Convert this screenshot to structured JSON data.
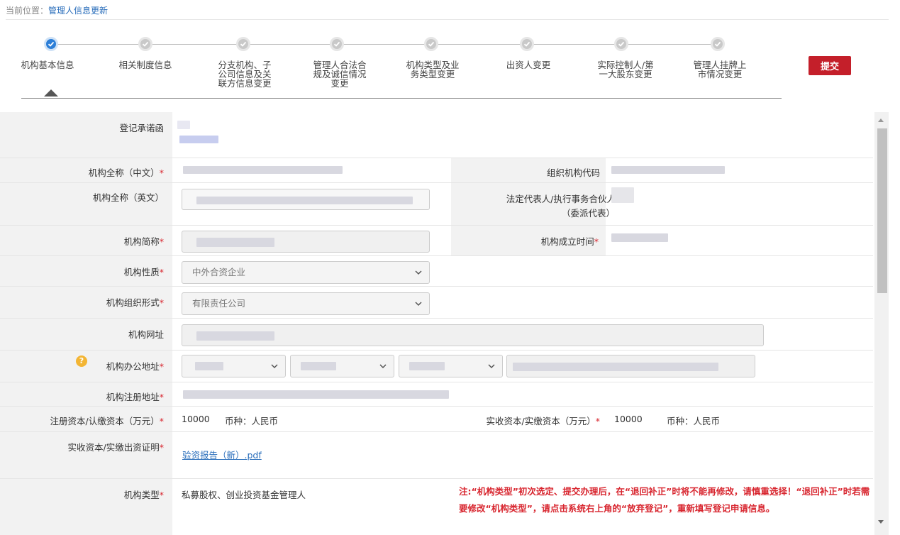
{
  "breadcrumb": {
    "prefix": "当前位置：",
    "current": "管理人信息更新"
  },
  "steps": [
    {
      "label": "机构基本信息",
      "state": "active"
    },
    {
      "label": "相关制度信息",
      "state": "done"
    },
    {
      "label": "分支机构、子\n公司信息及关\n联方信息变更",
      "state": "done"
    },
    {
      "label": "管理人合法合\n规及诚信情况\n变更",
      "state": "done"
    },
    {
      "label": "机构类型及业\n务类型变更",
      "state": "done"
    },
    {
      "label": "出资人变更",
      "state": "done"
    },
    {
      "label": "实际控制人/第\n一大股东变更",
      "state": "done"
    },
    {
      "label": "管理人挂牌上\n市情况变更",
      "state": "done"
    }
  ],
  "submit_label": "提交",
  "form": {
    "commitment_label": "登记承诺函",
    "name_cn_label": "机构全称（中文）",
    "org_code_label": "组织机构代码",
    "name_en_label": "机构全称（英文）",
    "legal_rep_label_1": "法定代表人/执行事务合伙人",
    "legal_rep_label_2": "（委派代表）",
    "short_name_label": "机构简称",
    "established_label": "机构成立时间",
    "nature_label": "机构性质",
    "nature_value": "中外合资企业",
    "org_form_label": "机构组织形式",
    "org_form_value": "有限责任公司",
    "website_label": "机构网址",
    "office_addr_label": "机构办公地址",
    "reg_addr_label": "机构注册地址",
    "reg_capital_label": "注册资本/认缴资本（万元）",
    "reg_capital_value": "10000",
    "reg_currency": "币种：人民币",
    "paid_capital_label": "实收资本/实缴资本（万元）",
    "paid_capital_value": "10000",
    "paid_currency": "币种：人民币",
    "paid_proof_label": "实收资本/实缴出资证明",
    "paid_proof_file": "验资报告（新）.pdf",
    "org_type_label": "机构类型",
    "org_type_value": "私募股权、创业投资基金管理人",
    "org_type_note": "注:“机构类型”初次选定、提交办理后，在“退回补正”时将不能再修改，请慎重选择！“退回补正”时若需要修改“机构类型”，请点击系统右上角的“放弃登记”，重新填写登记申请信息。",
    "required_mark": "*",
    "help_mark": "?"
  },
  "colors": {
    "accent": "#2d7fd8",
    "required": "#d8262f",
    "submit": "#c41f2a",
    "label_bg": "#f2f2f2"
  }
}
